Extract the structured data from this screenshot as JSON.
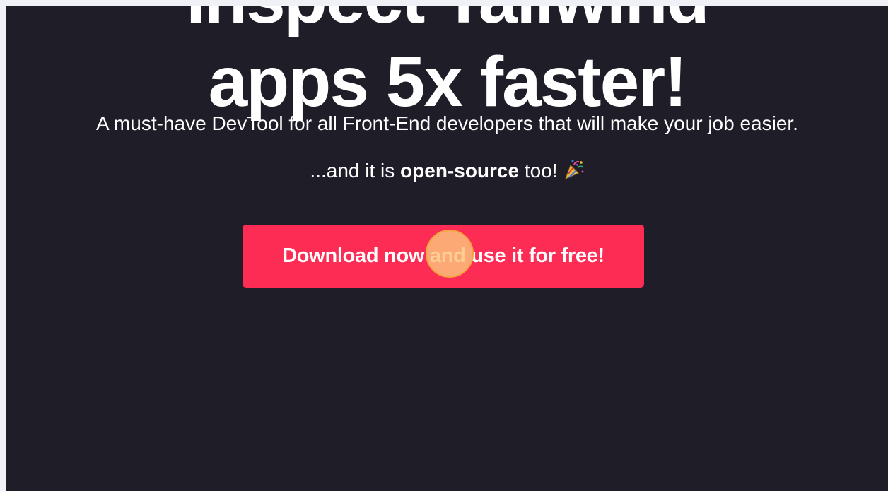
{
  "hero": {
    "heading_line1": "Inspect Tailwind",
    "heading_line2": "apps 5x faster!",
    "subtitle": "A must-have DevTool for all Front-End developers that will make your job easier.",
    "tagline_prefix": "...and it is ",
    "tagline_bold": "open-source",
    "tagline_suffix": " too!",
    "tagline_icon": "party-popper-icon"
  },
  "cta": {
    "label": "Download now and use it for free!"
  },
  "colors": {
    "page_background": "#1f1d28",
    "outer_background": "#f0f0f7",
    "text": "#ffffff",
    "cta_background": "#fd2c55",
    "click_marker": "#fcc47c"
  }
}
